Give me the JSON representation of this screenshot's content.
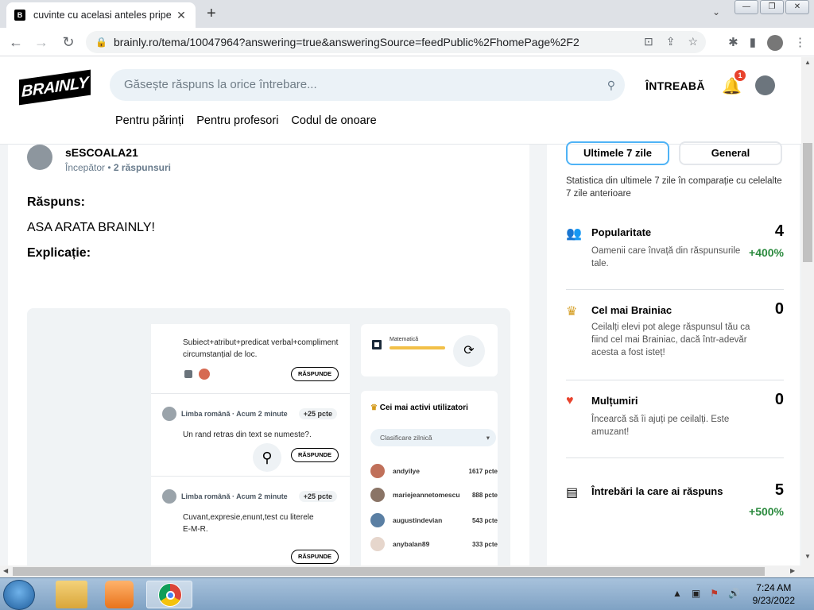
{
  "browser": {
    "tab_title": "cuvinte cu acelasi anteles pripe",
    "tab_close": "✕",
    "new_tab": "+",
    "url": "brainly.ro/tema/10047964?answering=true&answeringSource=feedPublic%2FhomePage%2F2"
  },
  "header": {
    "logo": "BRAINLY",
    "search_placeholder": "Găsește răspuns la orice întrebare...",
    "ask_button": "ÎNTREABĂ",
    "notifications_count": "1",
    "nav": [
      "Pentru părinți",
      "Pentru profesori",
      "Codul de onoare"
    ]
  },
  "answer": {
    "author": "sESCOALA21",
    "rank": "Începător",
    "answers_count": "2 răspunsuri",
    "answer_label": "Răspuns:",
    "answer_text": "ASA ARATA BRAINLY!",
    "explanation_label": "Explicație:"
  },
  "embedded": {
    "feed": [
      {
        "meta": "",
        "points": "",
        "text": "Subiect+atribut+predicat verbal+compliment circumstanțial de loc.",
        "button": "RĂSPUNDE"
      },
      {
        "meta": "Limba română · Acum 2 minute",
        "points": "+25 pcte",
        "text": "Un rand retras din text se numeste?.",
        "button": "RĂSPUNDE"
      },
      {
        "meta": "Limba română · Acum 2 minute",
        "points": "+25 pcte",
        "text": "Cuvant,expresie,enunt,test cu literele E-M-R.",
        "button": "RĂSPUNDE"
      }
    ],
    "subject": "Matematică",
    "top_users_title": "Cei mai activi utilizatori",
    "ranking_select": "Clasificare zilnică",
    "top_users": [
      {
        "name": "andyilye",
        "points": "1617 pcte"
      },
      {
        "name": "mariejeannetomescu",
        "points": "888 pcte"
      },
      {
        "name": "augustindevian",
        "points": "543 pcte"
      },
      {
        "name": "anybalan89",
        "points": "333 pcte"
      }
    ]
  },
  "sidebar": {
    "tab_week": "Ultimele 7 zile",
    "tab_general": "General",
    "description": "Statistica din ultimele 7 zile în comparație cu celelalte 7 zile anterioare",
    "stats": [
      {
        "icon": "people-icon",
        "title": "Popularitate",
        "value": "4",
        "change": "+400%",
        "desc": "Oamenii care învață din răspunsurile tale."
      },
      {
        "icon": "crown-icon",
        "title": "Cel mai Brainiac",
        "value": "0",
        "change": "",
        "desc": "Ceilalți elevi pot alege răspunsul tău ca fiind cel mai Brainiac, dacă într-adevăr acesta a fost isteț!"
      },
      {
        "icon": "heart-icon",
        "title": "Mulțumiri",
        "value": "0",
        "change": "",
        "desc": "Încearcă să îi ajuți pe ceilalți. Este amuzant!"
      },
      {
        "icon": "questions-icon",
        "title": "Întrebări la care ai răspuns",
        "value": "5",
        "change": "+500%",
        "desc": ""
      }
    ]
  },
  "taskbar": {
    "time": "7:24 AM",
    "date": "9/23/2022"
  },
  "colors": {
    "accent_blue": "#4fb3f6",
    "positive_green": "#2b8a3e",
    "badge_red": "#e8432d"
  }
}
